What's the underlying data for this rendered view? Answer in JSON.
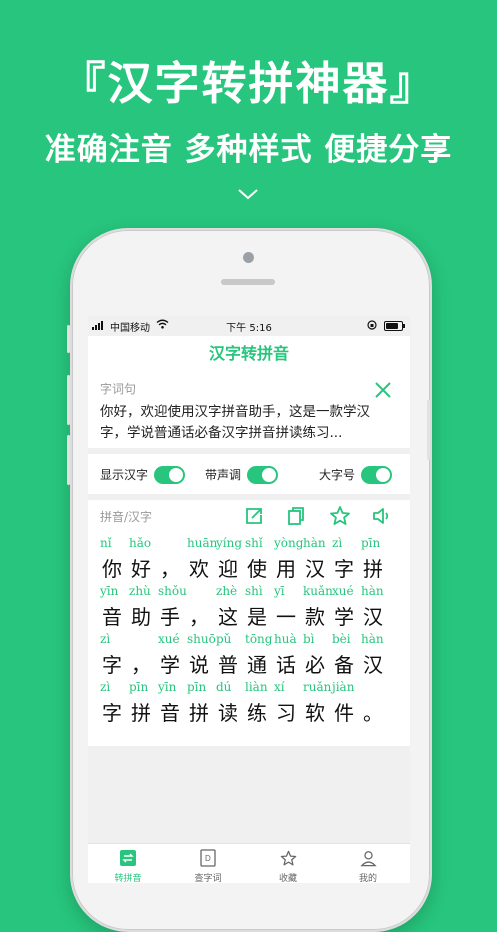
{
  "hero": {
    "title": "『汉字转拼神器』",
    "subtitle": "准确注音 多种样式 便捷分享",
    "arrow_icon": "chevron-down-icon"
  },
  "status_bar": {
    "carrier": "中国移动",
    "time": "下午 5:16"
  },
  "app": {
    "title": "汉字转拼音"
  },
  "input": {
    "label": "字词句",
    "text": "你好，欢迎使用汉字拼音助手，这是一款学汉字，学说普通话必备汉字拼音拼读练习..."
  },
  "toggles": [
    {
      "label": "显示汉字",
      "on": true
    },
    {
      "label": "带声调",
      "on": true
    },
    {
      "label": "大字号",
      "on": true
    }
  ],
  "result": {
    "label": "拼音/汉字",
    "tools": [
      "share-icon",
      "copy-icon",
      "star-icon",
      "speaker-icon"
    ],
    "lines": [
      [
        {
          "py": "nǐ",
          "hz": "你"
        },
        {
          "py": "hǎo",
          "hz": "好"
        },
        {
          "py": "",
          "hz": "，"
        },
        {
          "py": "huān",
          "hz": "欢"
        },
        {
          "py": "yíng",
          "hz": "迎"
        },
        {
          "py": "shǐ",
          "hz": "使"
        },
        {
          "py": "yòng",
          "hz": "用"
        },
        {
          "py": "hàn",
          "hz": "汉"
        },
        {
          "py": "zì",
          "hz": "字"
        },
        {
          "py": "pīn",
          "hz": "拼"
        }
      ],
      [
        {
          "py": "yīn",
          "hz": "音"
        },
        {
          "py": "zhù",
          "hz": "助"
        },
        {
          "py": "shǒu",
          "hz": "手"
        },
        {
          "py": "",
          "hz": "，"
        },
        {
          "py": "zhè",
          "hz": "这"
        },
        {
          "py": "shì",
          "hz": "是"
        },
        {
          "py": "yī",
          "hz": "一"
        },
        {
          "py": "kuǎn",
          "hz": "款"
        },
        {
          "py": "xué",
          "hz": "学"
        },
        {
          "py": "hàn",
          "hz": "汉"
        }
      ],
      [
        {
          "py": "zì",
          "hz": "字"
        },
        {
          "py": "",
          "hz": "，"
        },
        {
          "py": "xué",
          "hz": "学"
        },
        {
          "py": "shuō",
          "hz": "说"
        },
        {
          "py": "pǔ",
          "hz": "普"
        },
        {
          "py": "tōng",
          "hz": "通"
        },
        {
          "py": "huà",
          "hz": "话"
        },
        {
          "py": "bì",
          "hz": "必"
        },
        {
          "py": "bèi",
          "hz": "备"
        },
        {
          "py": "hàn",
          "hz": "汉"
        }
      ],
      [
        {
          "py": "zì",
          "hz": "字"
        },
        {
          "py": "pīn",
          "hz": "拼"
        },
        {
          "py": "yīn",
          "hz": "音"
        },
        {
          "py": "pīn",
          "hz": "拼"
        },
        {
          "py": "dú",
          "hz": "读"
        },
        {
          "py": "liàn",
          "hz": "练"
        },
        {
          "py": "xí",
          "hz": "习"
        },
        {
          "py": "ruǎn",
          "hz": "软"
        },
        {
          "py": "jiàn",
          "hz": "件"
        },
        {
          "py": "",
          "hz": "。"
        }
      ]
    ]
  },
  "tabbar": [
    {
      "label": "转拼音",
      "icon": "convert-icon",
      "active": true
    },
    {
      "label": "查字词",
      "icon": "dictionary-icon",
      "active": false
    },
    {
      "label": "收藏",
      "icon": "star-icon",
      "active": false
    },
    {
      "label": "我的",
      "icon": "user-icon",
      "active": false
    }
  ],
  "colors": {
    "accent": "#27c57d",
    "background": "#27c57d",
    "text": "#111111",
    "muted": "#999999"
  }
}
